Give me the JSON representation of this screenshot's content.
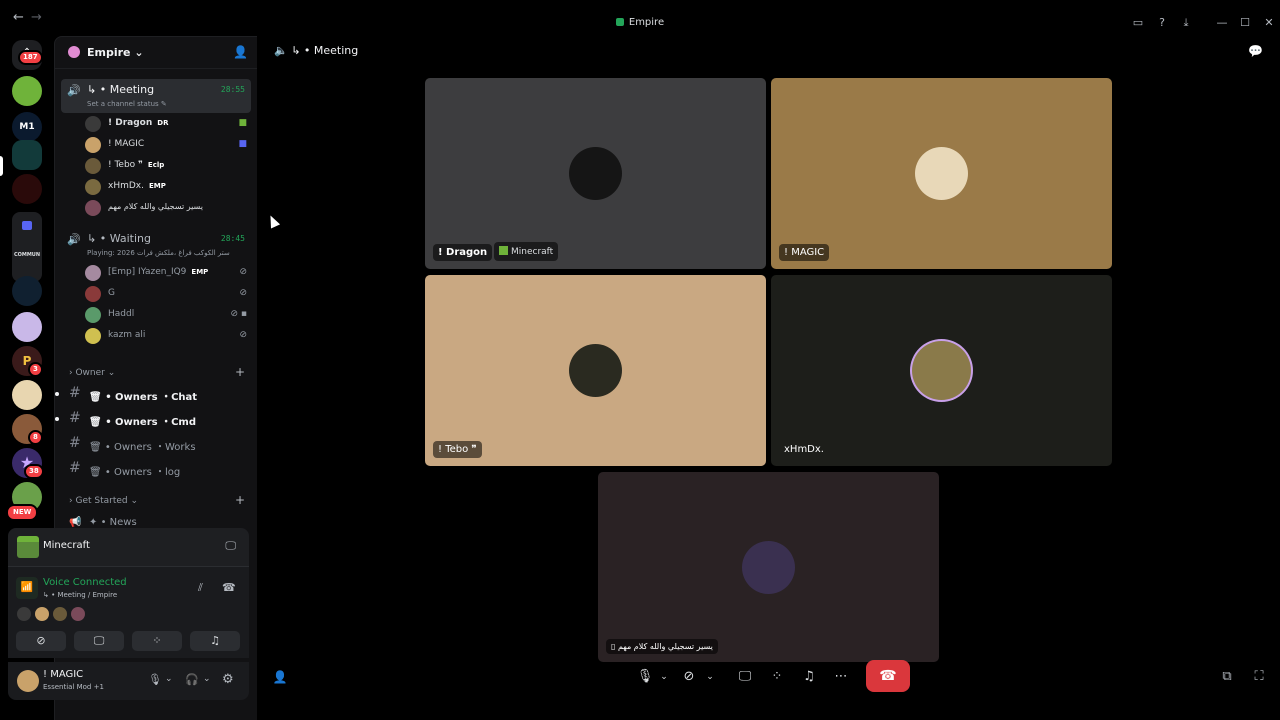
{
  "window": {
    "title": "Empire",
    "back": "←",
    "forward": "→"
  },
  "rail": {
    "badges": {
      "home": "187",
      "s8": "3",
      "s10": "8",
      "s11": "38",
      "new": "NEW"
    },
    "community_label": "COMMUN"
  },
  "guild": {
    "name": "Empire"
  },
  "channels": {
    "meeting": {
      "name": "↳ • Meeting",
      "time": "28:55",
      "status": "Set a channel status"
    },
    "meeting_members": [
      {
        "name": "! Dragon",
        "tag": "DR",
        "color": "#3a3a3a"
      },
      {
        "name": "! MAGIC",
        "tag": "",
        "color": "#c9a26a"
      },
      {
        "name": "! Tebo ❞",
        "tag": "Eclp",
        "color": "#6a5a3a"
      },
      {
        "name": "xHmDx.",
        "tag": "EMP",
        "color": "#7a6a40"
      },
      {
        "name": "يسير تسجيلي والله كلام مهم",
        "tag": "",
        "color": "#7a4a5a"
      }
    ],
    "waiting": {
      "name": "↳ • Waiting",
      "time": "28:45",
      "sub": "Playing: 2026 ستر الكوكب فراغ ،ملكش فرات"
    },
    "waiting_members": [
      {
        "name": "[Emp] IYazen_IQ9",
        "tag": "EMP",
        "color": "#a58aa0"
      },
      {
        "name": "G",
        "tag": "",
        "color": "#8a3a3a"
      },
      {
        "name": "Haddl",
        "tag": "",
        "color": "#5a9a6a"
      },
      {
        "name": "kazm ali",
        "tag": "",
        "color": "#d0c050"
      }
    ],
    "owner_category": "Owner",
    "owner_channels": [
      {
        "name": "• Owners ・Chat"
      },
      {
        "name": "• Owners ・Cmd"
      },
      {
        "name": "• Owners ・Works"
      },
      {
        "name": "• Owners ・log"
      }
    ],
    "getstarted_category": "Get Started",
    "news_channel": "• News"
  },
  "activity": {
    "game": "Minecraft"
  },
  "voice": {
    "status": "Voice Connected",
    "location": "↳ • Meeting / Empire"
  },
  "user": {
    "name": "! MAGIC",
    "status": "Essential Mod +1"
  },
  "main": {
    "header": "↳ • Meeting"
  },
  "tiles": [
    {
      "label": "! Dragon",
      "game": "Minecraft",
      "bg": "#3d3d3f"
    },
    {
      "label": "! MAGIC",
      "bg": "#9a7a48"
    },
    {
      "label": "! Tebo ❞",
      "bg": "#c9a882"
    },
    {
      "label": "xHmDx.",
      "bg": "#1d1e1a"
    },
    {
      "label": "يسير تسجيلي والله كلام مهم",
      "bg": "#2a2224"
    }
  ],
  "colors": {
    "accent_green": "#23a559",
    "hangup_red": "#da373c"
  }
}
